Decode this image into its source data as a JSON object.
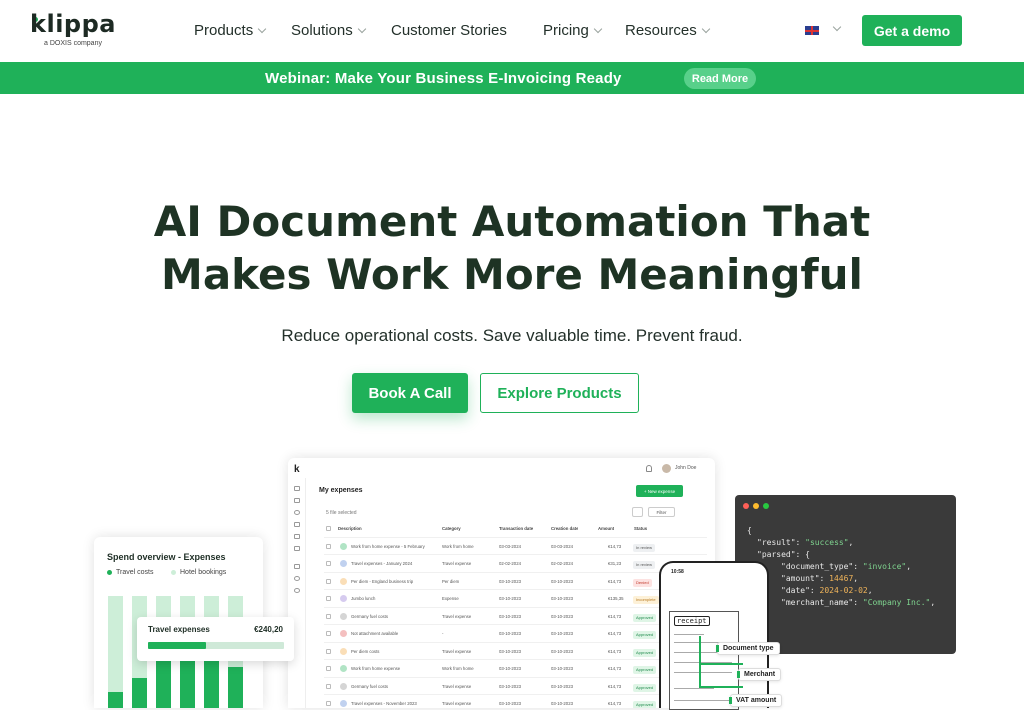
{
  "header": {
    "logo_text": "klippa",
    "logo_sub": "a DOXIS company",
    "nav": [
      {
        "label": "Products",
        "has_dropdown": true
      },
      {
        "label": "Solutions",
        "has_dropdown": true
      },
      {
        "label": "Customer Stories",
        "has_dropdown": false
      },
      {
        "label": "Pricing",
        "has_dropdown": true
      },
      {
        "label": "Resources",
        "has_dropdown": true
      }
    ],
    "language_flag": "uk-flag-icon",
    "cta_label": "Get a demo"
  },
  "banner": {
    "text": "Webinar: Make Your Business E-Invoicing Ready",
    "button_label": "Read More"
  },
  "hero": {
    "title_line1": "AI Document Automation That",
    "title_line2": "Makes Work More Meaningful",
    "subtitle": "Reduce operational costs. Save valuable time. Prevent fraud.",
    "primary_cta": "Book A Call",
    "secondary_cta": "Explore Products"
  },
  "app_mock": {
    "title": "My expenses",
    "user": "John Doe",
    "new_button": "+ New expense",
    "selected_text": "5 file selected",
    "filter_label": "Filter",
    "columns": [
      "Description",
      "Category",
      "Transaction date",
      "Creation date",
      "Amount",
      "Status"
    ],
    "rows": [
      {
        "desc": "Work from home expense - 5 February",
        "cat": "Work from home",
        "tdate": "03-03-2024",
        "cdate": "03-03-2024",
        "amount": "€14,73",
        "status": "In review"
      },
      {
        "desc": "Travel expenses - January 2024",
        "cat": "Travel expense",
        "tdate": "02-02-2024",
        "cdate": "02-02-2024",
        "amount": "€31,23",
        "status": "In review"
      },
      {
        "desc": "Per diem - England business trip",
        "cat": "Per diem",
        "tdate": "03-10-2023",
        "cdate": "03-10-2023",
        "amount": "€14,73",
        "status": "Denied"
      },
      {
        "desc": "Jumbo lunch",
        "cat": "Expense",
        "tdate": "03-10-2023",
        "cdate": "03-10-2023",
        "amount": "€135,35",
        "status": "Incomplete"
      },
      {
        "desc": "Germany fuel costs",
        "cat": "Travel expense",
        "tdate": "03-10-2023",
        "cdate": "03-10-2023",
        "amount": "€14,73",
        "status": "Approved"
      },
      {
        "desc": "Not attachment available",
        "cat": "-",
        "tdate": "03-10-2023",
        "cdate": "03-10-2023",
        "amount": "€14,73",
        "status": "Approved"
      },
      {
        "desc": "Per diem costs",
        "cat": "Travel expense",
        "tdate": "03-10-2023",
        "cdate": "03-10-2023",
        "amount": "€14,73",
        "status": "Approved"
      },
      {
        "desc": "Work from home expense",
        "cat": "Work from home",
        "tdate": "03-10-2023",
        "cdate": "03-10-2023",
        "amount": "€14,73",
        "status": "Approved"
      },
      {
        "desc": "Germany fuel costs",
        "cat": "Travel expense",
        "tdate": "03-10-2023",
        "cdate": "03-10-2023",
        "amount": "€14,73",
        "status": "Approved"
      },
      {
        "desc": "Travel expenses - November 2023",
        "cat": "Travel expense",
        "tdate": "03-10-2023",
        "cdate": "03-10-2023",
        "amount": "€14,73",
        "status": "Approved"
      }
    ]
  },
  "spend": {
    "title": "Spend overview - Expenses",
    "legend": [
      "Travel costs",
      "Hotel bookings"
    ],
    "colors": {
      "travel": "#1fb159",
      "hotel": "#cdeed8"
    },
    "travel_fractions": [
      0.14,
      0.27,
      0.42,
      0.42,
      0.42,
      0.37
    ],
    "card_label": "Travel expenses",
    "card_amount": "€240,20",
    "card_progress": 0.43
  },
  "json_card": {
    "open": "{",
    "result_key": "\"result\"",
    "result_val": "\"success\"",
    "parsed_key": "\"parsed\"",
    "doc_type_key": "\"document_type\"",
    "doc_type_val": "\"invoice\"",
    "amount_key": "\"amount\"",
    "amount_val": "14467",
    "date_key": "\"date\"",
    "date_val": "2024-02-02",
    "merchant_key": "\"merchant_name\"",
    "merchant_val": "\"Company Inc.\""
  },
  "phone": {
    "time": "10:58",
    "receipt_title": "receipt",
    "tags": [
      "Document type",
      "Merchant",
      "VAT amount"
    ]
  },
  "colors": {
    "accent": "#1fb159",
    "dark_text": "#1e3324",
    "approved_bg": "#dff5e6",
    "denied_bg": "#fde2e1",
    "incomplete_bg": "#fdf1d8"
  }
}
